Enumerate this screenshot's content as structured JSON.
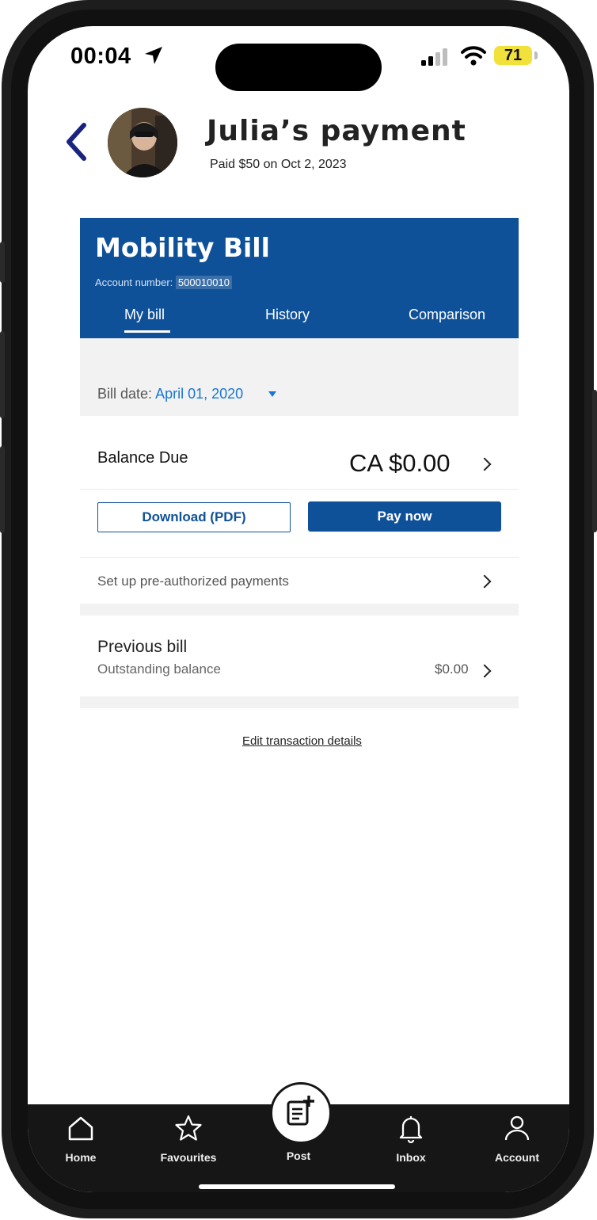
{
  "status_bar": {
    "time": "00:04",
    "battery": "71",
    "battery_color": "#f2e13b"
  },
  "header": {
    "back_icon": "chevron-left-icon",
    "title": "Julia’s payment",
    "subtitle": "Paid $50 on Oct 2, 2023"
  },
  "bill": {
    "title": "Mobility Bill",
    "account_label": "Account number:",
    "account_number": "500010010",
    "tabs": [
      {
        "label": "My bill",
        "active": true
      },
      {
        "label": "History",
        "active": false
      },
      {
        "label": "Comparison",
        "active": false
      }
    ],
    "bill_date_label": "Bill date:",
    "bill_date_value": "April 01, 2020",
    "balance_label": "Balance Due",
    "balance_value": "CA $0.00",
    "download_label": "Download (PDF)",
    "pay_label": "Pay now",
    "setup_label": "Set up pre-authorized payments",
    "previous_title": "Previous bill",
    "previous_sub": "Outstanding balance",
    "previous_value": "$0.00",
    "brand_color": "#0f5199",
    "link_color": "#1877d6"
  },
  "edit_link": "Edit transaction details",
  "nav": {
    "items": [
      {
        "label": "Home",
        "icon": "home-icon"
      },
      {
        "label": "Favourites",
        "icon": "star-icon"
      },
      {
        "label": "Post",
        "icon": "post-icon"
      },
      {
        "label": "Inbox",
        "icon": "bell-icon"
      },
      {
        "label": "Account",
        "icon": "person-icon"
      }
    ]
  }
}
